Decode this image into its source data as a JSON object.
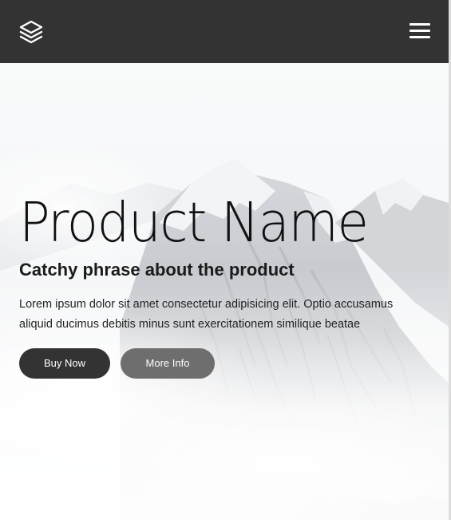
{
  "navbar": {
    "background": "#333333",
    "logo_icon": "layers-icon",
    "menu_icon": "hamburger-menu-icon"
  },
  "hero": {
    "background_image": "snowy-mountain-peaks",
    "title": "Product Name",
    "subtitle": "Catchy phrase about the product",
    "description": "Lorem ipsum dolor sit amet consectetur adipisicing elit. Optio accusamus aliquid ducimus debitis minus sunt exercitationem similique beatae",
    "buttons": {
      "primary_label": "Buy Now",
      "primary_color": "#333333",
      "secondary_label": "More Info",
      "secondary_color": "#6e6e6e"
    }
  }
}
